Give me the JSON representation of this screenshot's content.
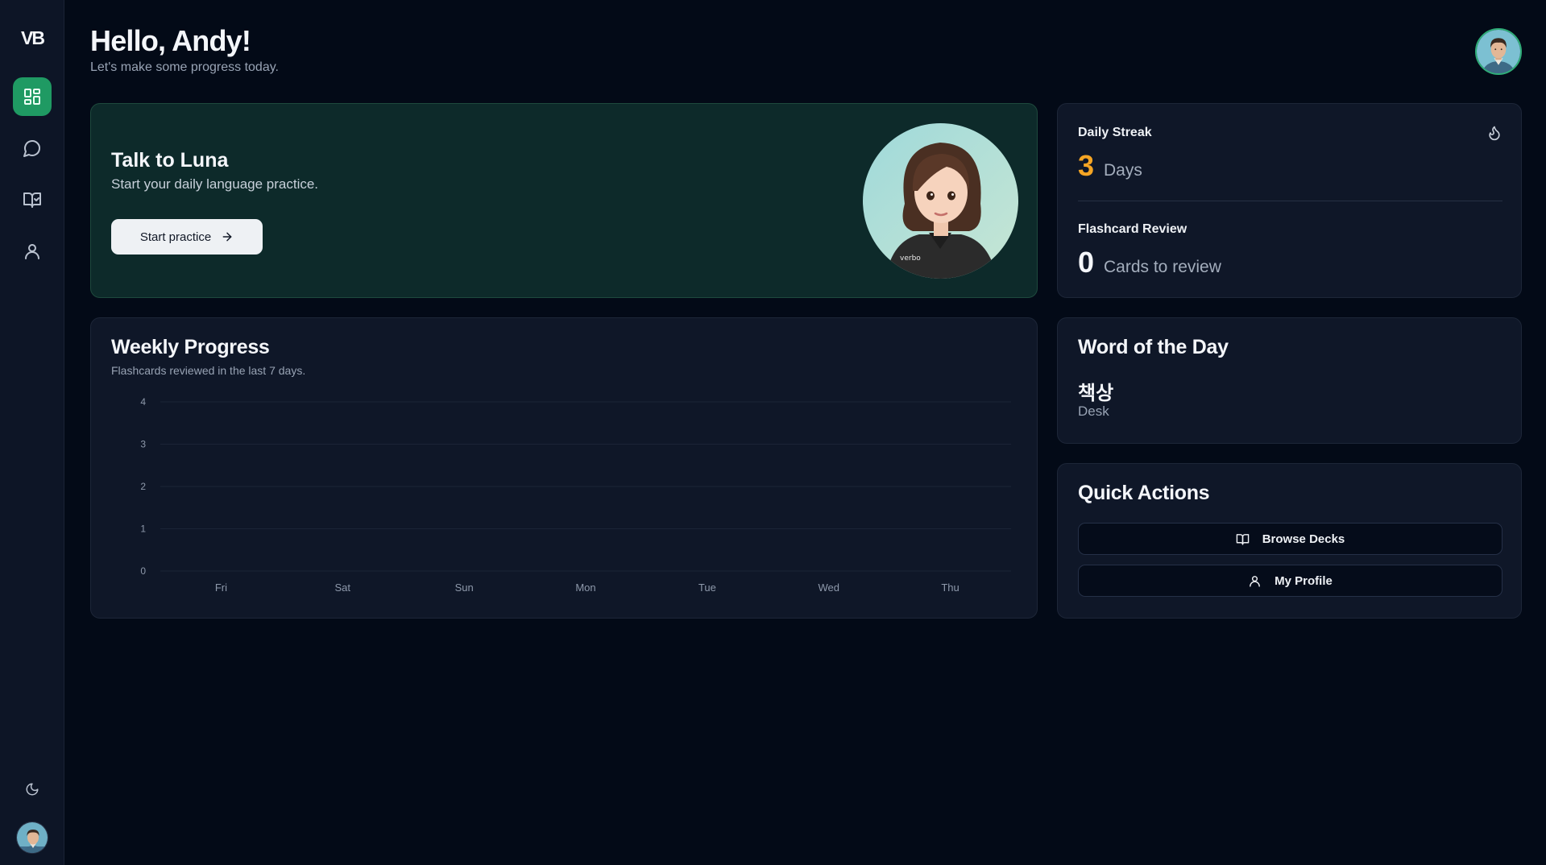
{
  "sidebar": {
    "logo": "VB",
    "items": [
      {
        "icon": "dashboard-icon",
        "active": true
      },
      {
        "icon": "chat-icon",
        "active": false
      },
      {
        "icon": "book-check-icon",
        "active": false
      },
      {
        "icon": "user-icon",
        "active": false
      }
    ],
    "theme_icon": "moon-icon"
  },
  "header": {
    "greeting": "Hello, Andy!",
    "subtitle": "Let's make some progress today."
  },
  "hero": {
    "title": "Talk to Luna",
    "subtitle": "Start your daily language practice.",
    "button_label": "Start practice",
    "badge_text": "verbo"
  },
  "stats": {
    "streak_label": "Daily Streak",
    "streak_value": "3",
    "streak_unit": "Days",
    "flashcard_label": "Flashcard Review",
    "flashcard_value": "0",
    "flashcard_unit": "Cards to review"
  },
  "weekly": {
    "title": "Weekly Progress",
    "subtitle": "Flashcards reviewed in the last 7 days."
  },
  "chart_data": {
    "type": "bar",
    "categories": [
      "Fri",
      "Sat",
      "Sun",
      "Mon",
      "Tue",
      "Wed",
      "Thu"
    ],
    "values": [
      0,
      0,
      0,
      0,
      0,
      0,
      0
    ],
    "yticks": [
      "0",
      "1",
      "2",
      "3",
      "4"
    ],
    "ylim": [
      0,
      4
    ],
    "grid": true,
    "title": "",
    "xlabel": "",
    "ylabel": ""
  },
  "word_of_day": {
    "title": "Word of the Day",
    "word": "책상",
    "meaning": "Desk"
  },
  "quick_actions": {
    "title": "Quick Actions",
    "browse_label": "Browse Decks",
    "profile_label": "My Profile"
  },
  "colors": {
    "accent": "#1f9a63",
    "streak": "#f5a524",
    "background": "#030a17"
  }
}
